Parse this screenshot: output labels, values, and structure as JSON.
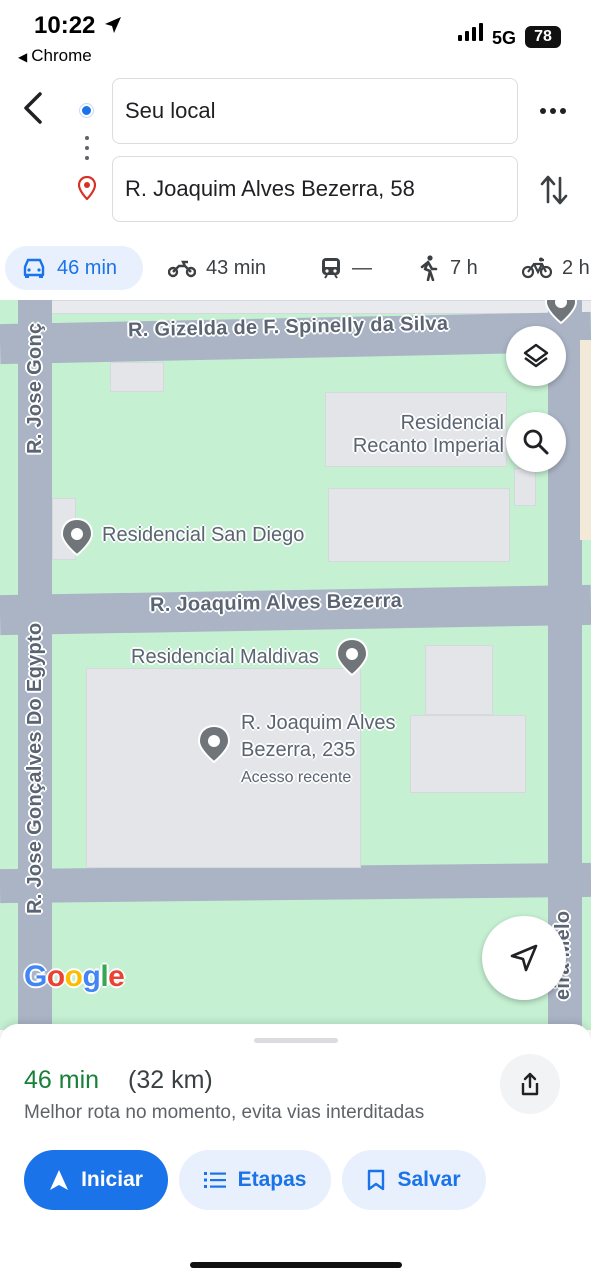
{
  "status_bar": {
    "time": "10:22",
    "back_app": "Chrome",
    "network": "5G",
    "battery": "78"
  },
  "route": {
    "origin": "Seu local",
    "destination": "R. Joaquim Alves Bezerra, 58"
  },
  "modes": [
    {
      "icon": "car-icon",
      "value": "46 min",
      "active": true
    },
    {
      "icon": "motorcycle-icon",
      "value": "43 min"
    },
    {
      "icon": "transit-icon",
      "value": "—"
    },
    {
      "icon": "walk-icon",
      "value": "7 h"
    },
    {
      "icon": "bike-icon",
      "value": "2 h"
    }
  ],
  "map": {
    "streets": {
      "gizelda": "R. Gizelda de F. Spinelly da Silva",
      "joaquim": "R. Joaquim Alves Bezerra",
      "jose_top": "R. Jose Gonç",
      "jose_main": "R. Jose Gonçalves Do Egypto",
      "melo": "eira Melo"
    },
    "places": {
      "recanto_line1": "Residencial",
      "recanto_line2": "Recanto Imperial",
      "san_diego": "Residencial San Diego",
      "maldivas": "Residencial Maldivas",
      "joaquim_235_line1": "R. Joaquim Alves",
      "joaquim_235_line2": "Bezerra, 235",
      "recent": "Acesso recente"
    },
    "logo": "Google"
  },
  "summary": {
    "eta": "46 min",
    "distance": "(32 km)",
    "note": "Melhor rota no momento, evita vias interditadas"
  },
  "actions": {
    "start": "Iniciar",
    "steps": "Etapas",
    "save": "Salvar"
  },
  "colors": {
    "accent": "#1a73e8",
    "eta_green": "#188038",
    "map_green": "#c5f0d2",
    "road": "#aab4c5"
  }
}
